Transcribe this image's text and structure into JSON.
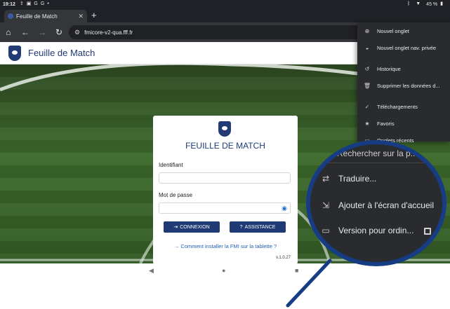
{
  "status_bar": {
    "time": "19:12",
    "battery": "45 %"
  },
  "tab": {
    "title": "Feuille de Match",
    "close": "✕"
  },
  "new_tab_symbol": "+",
  "address": {
    "url": "fmicore-v2-qua.fff.fr"
  },
  "site": {
    "header_title": "Feuille de Match"
  },
  "login": {
    "title": "FEUILLE DE MATCH",
    "id_label": "Identifiant",
    "password_label": "Mot de passe",
    "login_button": "CONNEXION",
    "assistance_button": "ASSISTANCE",
    "install_link": "→ Comment installer la FMI sur la tablette ?",
    "version": "v.1.0.27"
  },
  "menu": {
    "items": [
      {
        "icon": "new-tab-icon",
        "glyph": "⊕",
        "label": "Nouvel onglet"
      },
      {
        "icon": "incognito-icon",
        "glyph": "◒",
        "label": "Nouvel onglet nav. privée"
      },
      {
        "icon": "history-icon",
        "glyph": "↺",
        "label": "Historique"
      },
      {
        "icon": "trash-icon",
        "glyph": "🗑",
        "label": "Supprimer les données d..."
      },
      {
        "icon": "downloads-icon",
        "glyph": "✓",
        "label": "Téléchargements"
      },
      {
        "icon": "star-icon",
        "glyph": "★",
        "label": "Favoris"
      },
      {
        "icon": "recent-tabs-icon",
        "glyph": "▭",
        "label": "Onglets récents"
      }
    ]
  },
  "magnifier": {
    "search_partial": "Rechercher sur la p...",
    "translate": "Traduire...",
    "add_home": "Ajouter à l'écran d'accueil",
    "desktop": "Version pour ordin..."
  },
  "colors": {
    "brand": "#1f3a74",
    "callout": "#163d84"
  }
}
